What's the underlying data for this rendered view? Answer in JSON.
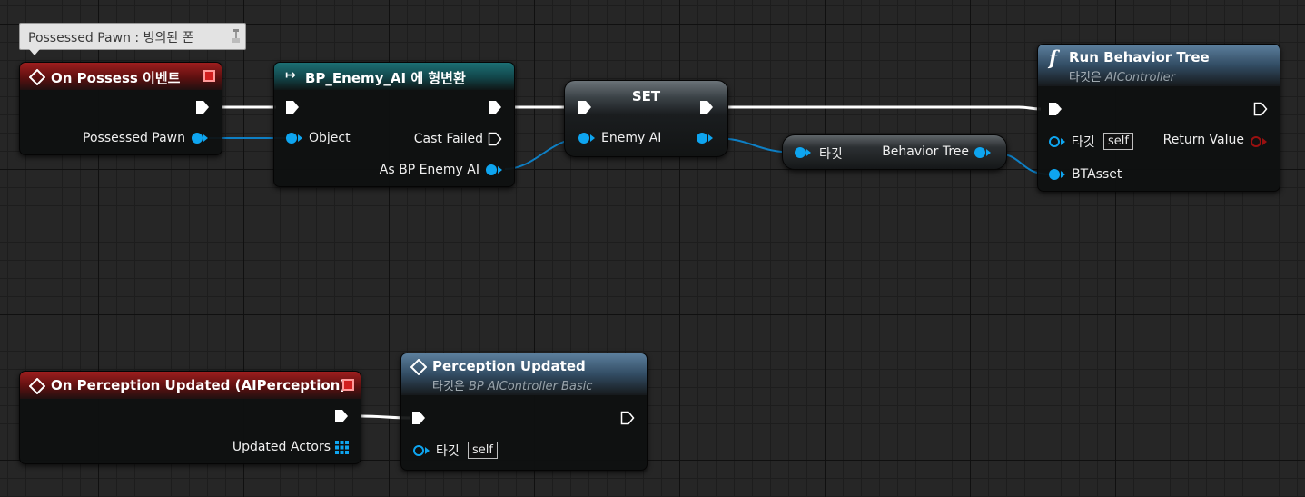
{
  "tooltip": {
    "text": "Possessed Pawn : 빙의된 폰",
    "icon": "pin-icon"
  },
  "nodes": {
    "on_possess": {
      "title": "On Possess 이벤트",
      "pin_pawn": "Possessed Pawn",
      "color": "#8b1a1a"
    },
    "cast": {
      "title": "BP_Enemy_AI 에 형변환",
      "pin_object": "Object",
      "pin_cast_failed": "Cast Failed",
      "pin_as": "As BP Enemy AI",
      "color": "#1c6f74"
    },
    "set": {
      "title": "SET",
      "pin_enemy": "Enemy AI"
    },
    "get": {
      "pin_target": "타깃",
      "pin_bt": "Behavior Tree"
    },
    "run_bt": {
      "title": "Run Behavior Tree",
      "subtitle_prefix": "타깃은 ",
      "subtitle_class": "AIController",
      "pin_target": "타깃",
      "self": "self",
      "pin_return": "Return Value",
      "pin_btasset": "BTAsset",
      "color": "#5c7f9d"
    },
    "on_perception": {
      "title": "On Perception Updated (AIPerception)",
      "pin_actors": "Updated Actors",
      "color": "#8b1a1a"
    },
    "perception": {
      "title": "Perception Updated",
      "subtitle_prefix": "타깃은 ",
      "subtitle_class": "BP AIController Basic",
      "pin_target": "타깃",
      "self": "self",
      "color": "#5c7f9d"
    }
  },
  "colors": {
    "exec": "#ffffff",
    "object": "#0ea5f0",
    "return": "#9a1010",
    "event_header": "#9e1e1e",
    "cast_header": "#1c6f74",
    "function_header": "#5c7f9d"
  }
}
